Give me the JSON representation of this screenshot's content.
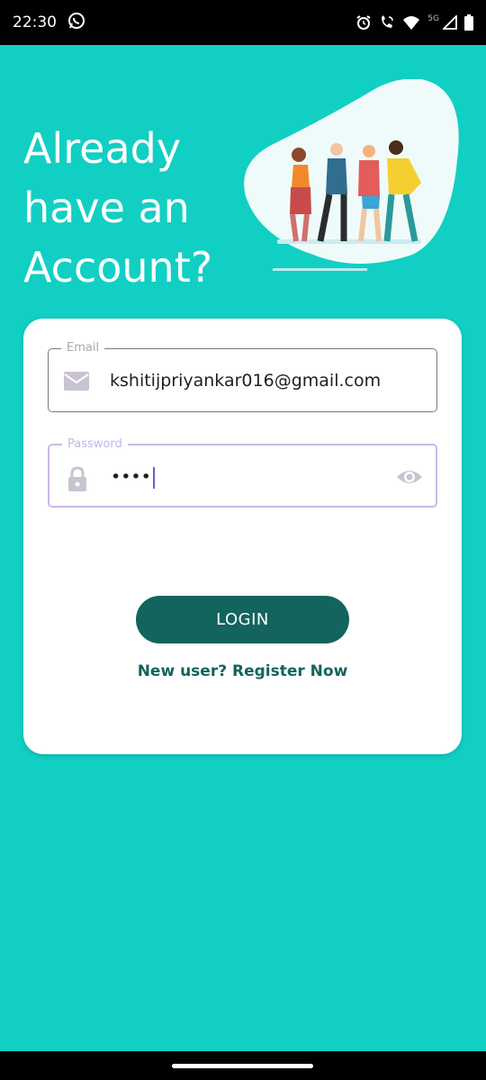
{
  "status_bar": {
    "time": "22:30",
    "network_label": "5G",
    "icons": [
      "whatsapp-icon",
      "alarm-icon",
      "wifi-call-icon",
      "wifi-icon",
      "signal-icon",
      "battery-icon"
    ]
  },
  "headline": {
    "lines": [
      "Already",
      "have an",
      "Account?"
    ]
  },
  "illustration": {
    "description_icon": "friends-group-illustration"
  },
  "form": {
    "email": {
      "label": "Email",
      "value": "kshitijpriyankar016@gmail.com",
      "icon": "mail-icon"
    },
    "password": {
      "label": "Password",
      "value": "••••",
      "icon": "lock-icon",
      "toggle_icon": "eye-icon"
    },
    "login_label": "LOGIN",
    "register_label": "New user? Register Now"
  },
  "colors": {
    "background": "#12cfc4",
    "button": "#12645c",
    "link": "#13645b",
    "focus": "#cbb8e8"
  }
}
